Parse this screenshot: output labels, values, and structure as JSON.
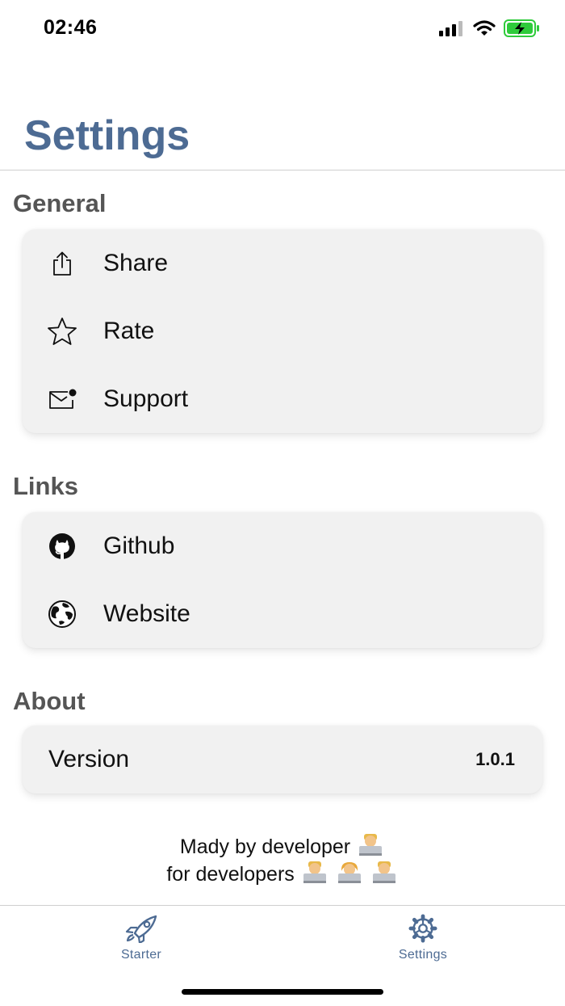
{
  "status_bar": {
    "time": "02:46",
    "icons": [
      "signal-icon",
      "wifi-icon",
      "battery-charging-icon"
    ],
    "battery_color": "#2fcb3b"
  },
  "header": {
    "title": "Settings",
    "title_color": "#4d6b93"
  },
  "sections": {
    "general": {
      "title": "General",
      "items": [
        {
          "label": "Share",
          "icon": "share-icon"
        },
        {
          "label": "Rate",
          "icon": "star-icon"
        },
        {
          "label": "Support",
          "icon": "mail-icon"
        }
      ]
    },
    "links": {
      "title": "Links",
      "items": [
        {
          "label": "Github",
          "icon": "github-icon"
        },
        {
          "label": "Website",
          "icon": "globe-icon"
        }
      ]
    },
    "about": {
      "title": "About",
      "version_label": "Version",
      "version_value": "1.0.1"
    }
  },
  "footer": {
    "line1": "Mady by developer",
    "line2": "for developers"
  },
  "tab_bar": {
    "tabs": [
      {
        "label": "Starter",
        "icon": "rocket-icon"
      },
      {
        "label": "Settings",
        "icon": "gear-icon"
      }
    ],
    "accent": "#4d6b93"
  }
}
